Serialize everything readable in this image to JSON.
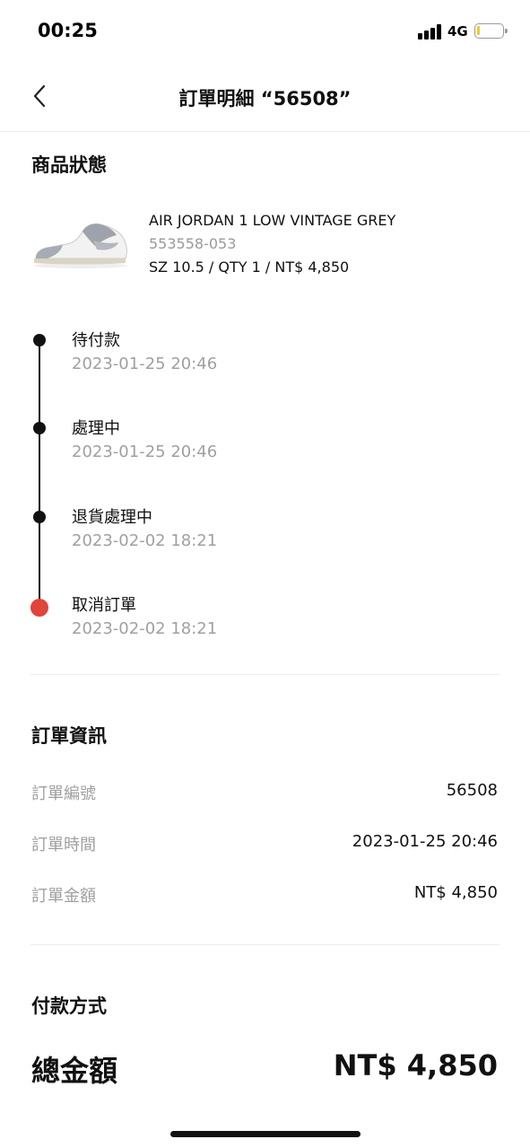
{
  "status_bar": {
    "time": "00:25",
    "network": "4G",
    "battery_color": "#f4c92b"
  },
  "nav": {
    "title": "訂單明細 “56508”",
    "back_icon": "chevron-left-icon"
  },
  "product_status": {
    "title": "商品狀態",
    "product": {
      "name": "AIR JORDAN 1 LOW VINTAGE GREY",
      "sku": "553558-053",
      "meta": "SZ 10.5 / QTY 1 / NT$ 4,850"
    },
    "timeline": [
      {
        "label": "待付款",
        "time": "2023-01-25 20:46"
      },
      {
        "label": "處理中",
        "time": "2023-01-25 20:46"
      },
      {
        "label": "退貨處理中",
        "time": "2023-02-02 18:21"
      },
      {
        "label": "取消訂單",
        "time": "2023-02-02 18:21"
      }
    ],
    "current_step_color": "#e0443a"
  },
  "order_info": {
    "title": "訂單資訊",
    "rows": [
      {
        "key": "訂單編號",
        "value": "56508"
      },
      {
        "key": "訂單時間",
        "value": "2023-01-25 20:46"
      },
      {
        "key": "訂單金額",
        "value": "NT$ 4,850"
      }
    ]
  },
  "payment": {
    "title": "付款方式"
  },
  "total": {
    "label": "總金額",
    "value": "NT$ 4,850"
  }
}
